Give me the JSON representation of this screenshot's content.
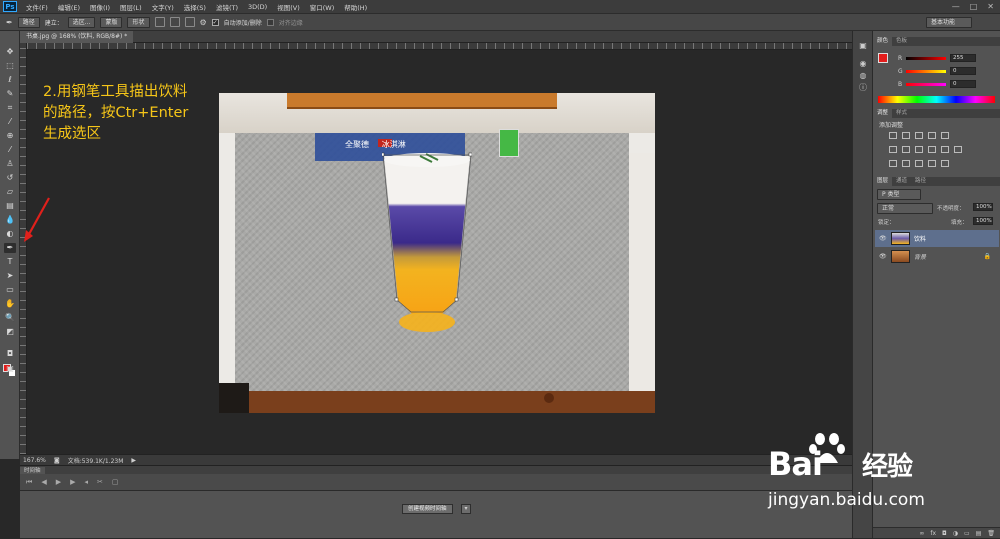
{
  "app": {
    "logo": "Ps"
  },
  "menu": [
    "文件(F)",
    "编辑(E)",
    "图像(I)",
    "图层(L)",
    "文字(Y)",
    "选择(S)",
    "滤镜(T)",
    "3D(D)",
    "视图(V)",
    "窗口(W)",
    "帮助(H)"
  ],
  "window_controls": [
    "—",
    "□",
    "✕"
  ],
  "options": {
    "mode": "路径",
    "make_label": "建立：",
    "selection_btn": "选区...",
    "mask_btn": "蒙版",
    "shape_btn": "形状",
    "auto_add_delete": "自动添加/删除",
    "align_edges": "对齐边缘",
    "workspace": "基本功能"
  },
  "document": {
    "tab_title": "书桌.jpg @ 168% (饮料, RGB/8#) *",
    "sign_text": "全聚德",
    "sign_text2": "冰淇淋"
  },
  "annotation": {
    "lines": [
      "2.用钢笔工具描出饮料",
      "的路径，按Ctr+Enter",
      "生成选区"
    ],
    "color": "#f5c518",
    "arrow_color": "#e0201b"
  },
  "status": {
    "zoom": "167.6%",
    "doc_info": "文档:539.1K/1.23M"
  },
  "timeline": {
    "tab": "时间轴",
    "create_btn": "创建视频时间轴"
  },
  "panels": {
    "color_tabs": [
      "颜色",
      "色板"
    ],
    "rgb": [
      {
        "label": "R",
        "value": "255"
      },
      {
        "label": "G",
        "value": "0"
      },
      {
        "label": "B",
        "value": "0"
      }
    ],
    "adjust_tabs": [
      "调整",
      "样式"
    ],
    "adjust_title": "添加调整",
    "layers_tabs": [
      "图层",
      "通道",
      "路径"
    ],
    "kind": "P 类型",
    "blend_mode": "正常",
    "opacity_label": "不透明度：",
    "opacity": "100%",
    "lock_label": "锁定：",
    "fill_label": "填充：",
    "fill": "100%",
    "layers": [
      {
        "name": "饮料",
        "selected": true
      },
      {
        "name": "背景",
        "selected": false,
        "locked": true
      }
    ],
    "bottom_icons": [
      "∞",
      "fx",
      "◘",
      "◑",
      "▭",
      "▤",
      "🗑"
    ]
  },
  "colors": {
    "foreground": "#e31d1c",
    "background": "#ffffff"
  },
  "watermark": {
    "brand": "Bai",
    "brand2": "经验",
    "url": "jingyan.baidu.com"
  }
}
